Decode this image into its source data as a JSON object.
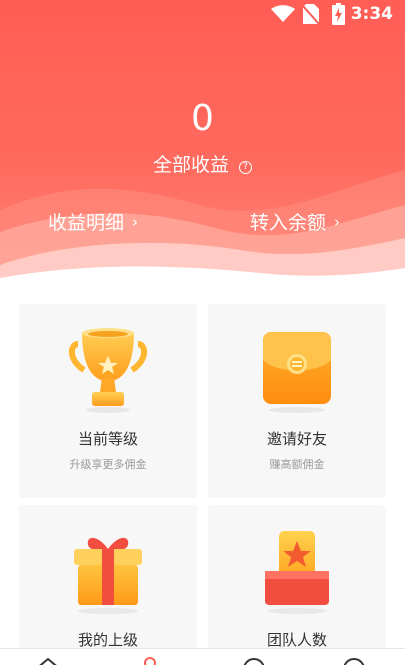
{
  "status_bar": {
    "time": "3:34"
  },
  "earnings": {
    "total_value": "0",
    "total_label": "全部收益",
    "help_icon": "?"
  },
  "links": {
    "details_label": "收益明细",
    "transfer_label": "转入余额",
    "chevron": "›"
  },
  "cards": [
    {
      "title": "当前等级",
      "subtitle": "升级享更多佣金",
      "icon": "trophy-icon"
    },
    {
      "title": "邀请好友",
      "subtitle": "赚高额佣金",
      "icon": "red-envelope-icon"
    },
    {
      "title": "我的上级",
      "subtitle": "",
      "icon": "gift-box-icon"
    },
    {
      "title": "团队人数",
      "subtitle": "",
      "icon": "star-box-icon"
    }
  ],
  "bottom_nav": {
    "icons": [
      "home-icon",
      "user-icon",
      "message-icon",
      "settings-icon"
    ]
  },
  "colors": {
    "header_top": "#ff5d55",
    "header_bottom": "#ff8a7c",
    "card_bg": "#f7f7f7",
    "gold": "#ffb62e",
    "red": "#f24e3f"
  }
}
